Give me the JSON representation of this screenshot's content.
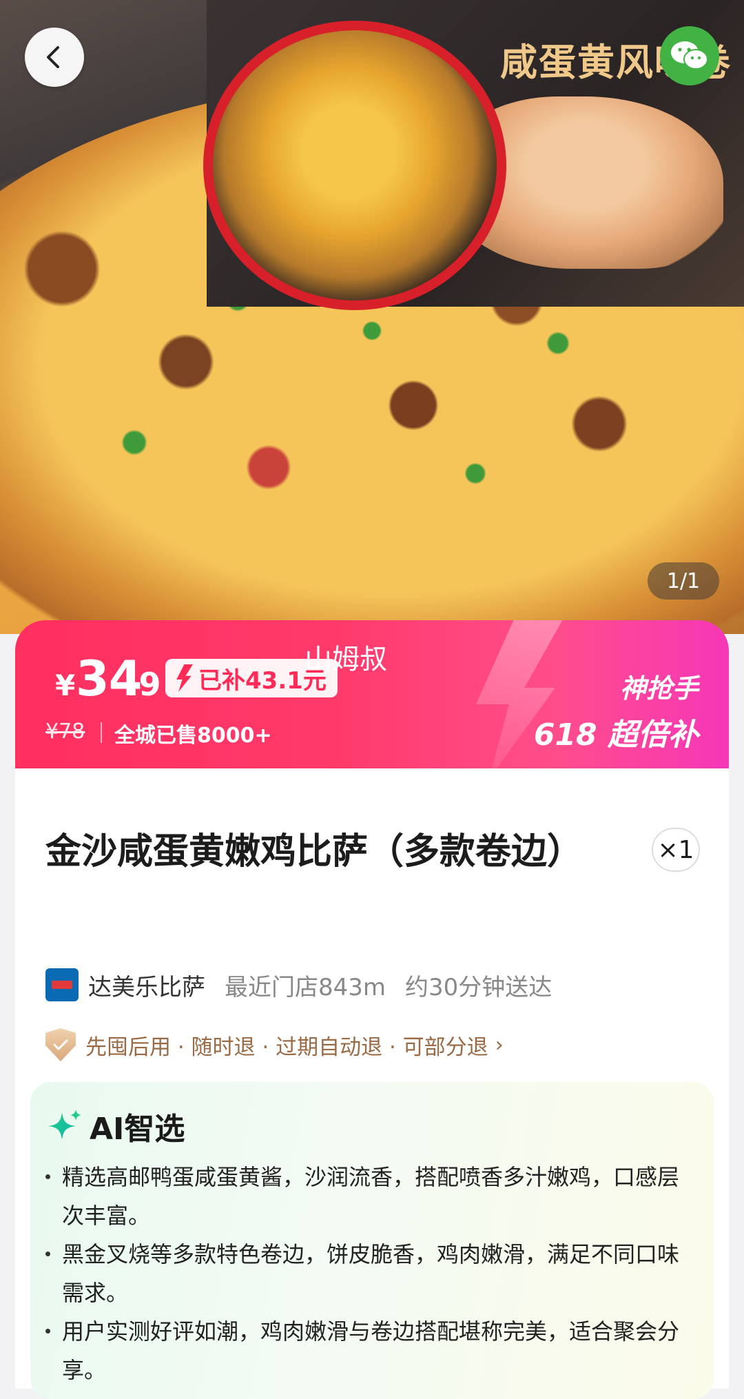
{
  "hero": {
    "inset_title": "咸蛋黄风味卷",
    "counter": "1/1"
  },
  "price": {
    "currency": "¥",
    "integer": "34",
    "decimal": ".9",
    "subsidy": "已补43.1元",
    "watermark": "山姆叔",
    "original": "¥78",
    "sold": "全城已售8000+",
    "promo_line1": "神抢手",
    "promo_line2": "618 超倍补",
    "accent_color": "#ff2f5f"
  },
  "product": {
    "title": "金沙咸蛋黄嫩鸡比萨（多款卷边）",
    "quantity": "×1"
  },
  "store": {
    "name": "达美乐比萨",
    "distance": "最近门店843m",
    "eta": "约30分钟送达"
  },
  "guarantee": {
    "text": "先囤后用 · 随时退 · 过期自动退 · 可部分退"
  },
  "ai": {
    "title": "AI智选",
    "bullets": [
      "精选高邮鸭蛋咸蛋黄酱，沙润流香，搭配喷香多汁嫩鸡，口感层次丰富。",
      "黑金叉烧等多款特色卷边，饼皮脆香，鸡肉嫩滑，满足不同口味需求。",
      "用户实测好评如潮，鸡肉嫩滑与卷边搭配堪称完美，适合聚会分享。"
    ]
  }
}
